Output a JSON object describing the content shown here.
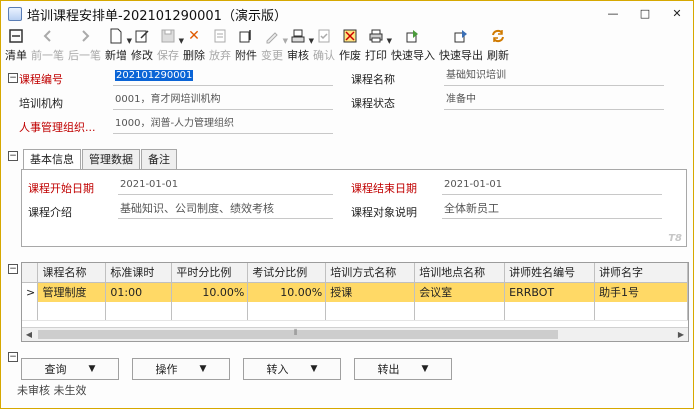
{
  "window": {
    "title": "培训课程安排单-202101290001（演示版）"
  },
  "window_controls": {
    "minimize": "—",
    "maximize": "□",
    "close": "✕"
  },
  "toolbar": {
    "clear": "清单",
    "prev": "前一笔",
    "next": "后一笔",
    "new": "新增",
    "edit": "修改",
    "save": "保存",
    "delete": "删除",
    "abandon": "放弃",
    "attach": "附件",
    "change": "变更",
    "audit": "审核",
    "confirm": "确认",
    "void": "作废",
    "print": "打印",
    "quick_import": "快速导入",
    "quick_export": "快速导出",
    "refresh": "刷新"
  },
  "header": {
    "course_no_label": "课程编号",
    "course_no": "202101290001",
    "course_name_label": "课程名称",
    "course_name": "基础知识培训",
    "training_org_label": "培训机构",
    "training_org": "0001，育才网培训机构",
    "course_status_label": "课程状态",
    "course_status": "准备中",
    "hr_org_label": "人事管理组织...",
    "hr_org": "1000，润普-人力管理组织"
  },
  "tabs": [
    "基本信息",
    "管理数据",
    "备注"
  ],
  "basic": {
    "start_date_label": "课程开始日期",
    "start_date": "2021-01-01",
    "end_date_label": "课程结束日期",
    "end_date": "2021-01-01",
    "intro_label": "课程介绍",
    "intro": "基础知识、公司制度、绩效考核",
    "target_label": "课程对象说明",
    "target": "全体新员工",
    "badge": "T8"
  },
  "grid": {
    "columns": [
      "课程名称",
      "标准课时",
      "平时分比例",
      "考试分比例",
      "培训方式名称",
      "培训地点名称",
      "讲师姓名编号",
      "讲师名字"
    ],
    "rows": [
      {
        "indicator": ">",
        "cells": [
          "管理制度",
          "01:00",
          "10.00%",
          "10.00%",
          "授课",
          "会议室",
          "ERRBOT",
          "助手1号"
        ]
      }
    ]
  },
  "buttons": {
    "query": "查询",
    "operate": "操作",
    "transfer_in": "转入",
    "transfer_out": "转出"
  },
  "status": {
    "text": "未审核 未生效"
  },
  "colors": {
    "selected_row": "#ffd966",
    "required_label": "#c00000",
    "window_border": "#d6a800"
  }
}
